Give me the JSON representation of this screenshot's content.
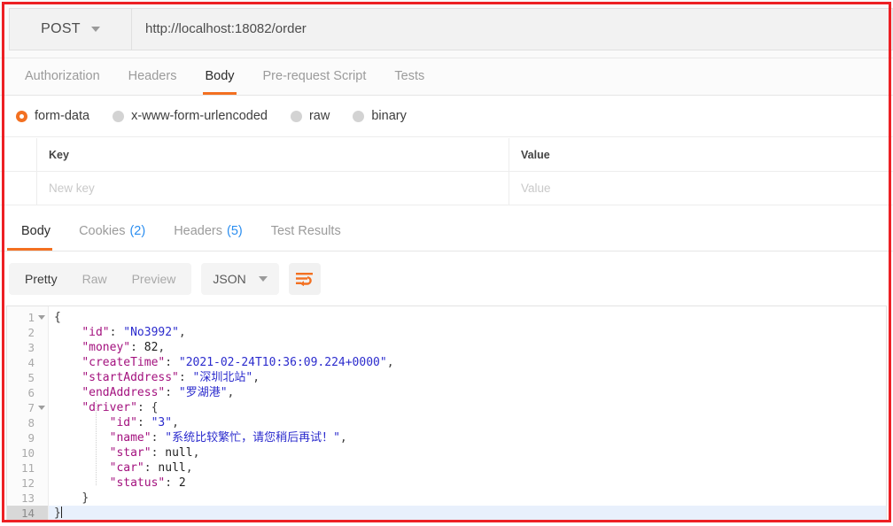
{
  "request": {
    "method": "POST",
    "method_caret_icon": "chevron-down-icon",
    "url": "http://localhost:18082/order",
    "tabs": [
      {
        "label": "Authorization",
        "active": false
      },
      {
        "label": "Headers",
        "active": false
      },
      {
        "label": "Body",
        "active": true
      },
      {
        "label": "Pre-request Script",
        "active": false
      },
      {
        "label": "Tests",
        "active": false
      }
    ],
    "body_types": [
      {
        "label": "form-data",
        "checked": true
      },
      {
        "label": "x-www-form-urlencoded",
        "checked": false
      },
      {
        "label": "raw",
        "checked": false
      },
      {
        "label": "binary",
        "checked": false
      }
    ],
    "table": {
      "headers": [
        "Key",
        "Value"
      ],
      "rows": [
        {
          "key_placeholder": "New key",
          "value_placeholder": "Value"
        }
      ]
    }
  },
  "response": {
    "tabs": [
      {
        "label": "Body",
        "count": "",
        "active": true
      },
      {
        "label": "Cookies",
        "count": "(2)",
        "active": false
      },
      {
        "label": "Headers",
        "count": "(5)",
        "active": false
      },
      {
        "label": "Test Results",
        "count": "",
        "active": false
      }
    ],
    "view_modes": [
      {
        "label": "Pretty",
        "active": true
      },
      {
        "label": "Raw",
        "active": false
      },
      {
        "label": "Preview",
        "active": false
      }
    ],
    "format": {
      "selected": "JSON",
      "caret_icon": "chevron-down-icon"
    },
    "wrap_button_icon": "wrap-text-icon",
    "code": {
      "language": "json",
      "current_line": 14,
      "lines": [
        {
          "num": "1",
          "foldable": true,
          "indent": 0,
          "tokens": [
            {
              "t": "{",
              "c": "p"
            }
          ]
        },
        {
          "num": "2",
          "foldable": false,
          "indent": 1,
          "tokens": [
            {
              "t": "\"id\"",
              "c": "k"
            },
            {
              "t": ": ",
              "c": "p"
            },
            {
              "t": "\"No3992\"",
              "c": "s"
            },
            {
              "t": ",",
              "c": "p"
            }
          ]
        },
        {
          "num": "3",
          "foldable": false,
          "indent": 1,
          "tokens": [
            {
              "t": "\"money\"",
              "c": "k"
            },
            {
              "t": ": ",
              "c": "p"
            },
            {
              "t": "82",
              "c": "n"
            },
            {
              "t": ",",
              "c": "p"
            }
          ]
        },
        {
          "num": "4",
          "foldable": false,
          "indent": 1,
          "tokens": [
            {
              "t": "\"createTime\"",
              "c": "k"
            },
            {
              "t": ": ",
              "c": "p"
            },
            {
              "t": "\"2021-02-24T10:36:09.224+0000\"",
              "c": "s"
            },
            {
              "t": ",",
              "c": "p"
            }
          ]
        },
        {
          "num": "5",
          "foldable": false,
          "indent": 1,
          "tokens": [
            {
              "t": "\"startAddress\"",
              "c": "k"
            },
            {
              "t": ": ",
              "c": "p"
            },
            {
              "t": "\"深圳北站\"",
              "c": "s"
            },
            {
              "t": ",",
              "c": "p"
            }
          ]
        },
        {
          "num": "6",
          "foldable": false,
          "indent": 1,
          "tokens": [
            {
              "t": "\"endAddress\"",
              "c": "k"
            },
            {
              "t": ": ",
              "c": "p"
            },
            {
              "t": "\"罗湖港\"",
              "c": "s"
            },
            {
              "t": ",",
              "c": "p"
            }
          ]
        },
        {
          "num": "7",
          "foldable": true,
          "indent": 1,
          "tokens": [
            {
              "t": "\"driver\"",
              "c": "k"
            },
            {
              "t": ": {",
              "c": "p"
            }
          ]
        },
        {
          "num": "8",
          "foldable": false,
          "indent": 2,
          "tokens": [
            {
              "t": "\"id\"",
              "c": "k"
            },
            {
              "t": ": ",
              "c": "p"
            },
            {
              "t": "\"3\"",
              "c": "s"
            },
            {
              "t": ",",
              "c": "p"
            }
          ]
        },
        {
          "num": "9",
          "foldable": false,
          "indent": 2,
          "tokens": [
            {
              "t": "\"name\"",
              "c": "k"
            },
            {
              "t": ": ",
              "c": "p"
            },
            {
              "t": "\"系统比较繁忙，请您稍后再试！\"",
              "c": "s"
            },
            {
              "t": ",",
              "c": "p"
            }
          ]
        },
        {
          "num": "10",
          "foldable": false,
          "indent": 2,
          "tokens": [
            {
              "t": "\"star\"",
              "c": "k"
            },
            {
              "t": ": ",
              "c": "p"
            },
            {
              "t": "null",
              "c": "n"
            },
            {
              "t": ",",
              "c": "p"
            }
          ]
        },
        {
          "num": "11",
          "foldable": false,
          "indent": 2,
          "tokens": [
            {
              "t": "\"car\"",
              "c": "k"
            },
            {
              "t": ": ",
              "c": "p"
            },
            {
              "t": "null",
              "c": "n"
            },
            {
              "t": ",",
              "c": "p"
            }
          ]
        },
        {
          "num": "12",
          "foldable": false,
          "indent": 2,
          "tokens": [
            {
              "t": "\"status\"",
              "c": "k"
            },
            {
              "t": ": ",
              "c": "p"
            },
            {
              "t": "2",
              "c": "n"
            }
          ]
        },
        {
          "num": "13",
          "foldable": false,
          "indent": 1,
          "tokens": [
            {
              "t": "}",
              "c": "p"
            }
          ]
        },
        {
          "num": "14",
          "foldable": false,
          "indent": 0,
          "tokens": [
            {
              "t": "}",
              "c": "p"
            }
          ]
        }
      ]
    }
  },
  "colors": {
    "accent": "#f37021",
    "annotation_frame": "#ed2024",
    "json_key": "#a3117e",
    "json_string": "#2b2bcd",
    "link_blue": "#2b8ef0"
  }
}
